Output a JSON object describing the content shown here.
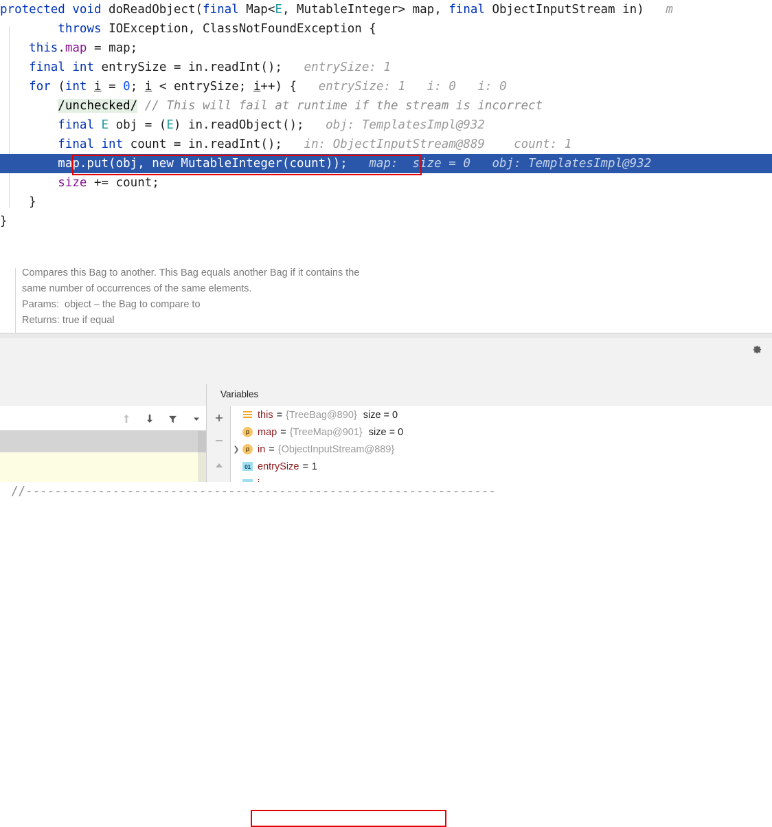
{
  "editor": {
    "lines": [
      {
        "id": "line1",
        "segments": [
          {
            "t": "protected ",
            "c": "kw"
          },
          {
            "t": "void ",
            "c": "kw"
          },
          {
            "t": "doReadObject(",
            "c": "tok"
          },
          {
            "t": "final ",
            "c": "kw"
          },
          {
            "t": "Map<",
            "c": "tok"
          },
          {
            "t": "E",
            "c": "gen"
          },
          {
            "t": ", MutableInteger> map, ",
            "c": "tok"
          },
          {
            "t": "final ",
            "c": "kw"
          },
          {
            "t": "ObjectInputStream in)",
            "c": "tok"
          },
          {
            "t": "   m",
            "c": "hint"
          }
        ]
      },
      {
        "id": "line2",
        "segments": [
          {
            "t": "        ",
            "c": "tok"
          },
          {
            "t": "throws ",
            "c": "kw"
          },
          {
            "t": "IOException, ClassNotFoundException {",
            "c": "tok"
          }
        ]
      },
      {
        "id": "line3",
        "segments": [
          {
            "t": "    ",
            "c": "tok"
          },
          {
            "t": "this",
            "c": "kw"
          },
          {
            "t": ".",
            "c": "tok"
          },
          {
            "t": "map",
            "c": "fld"
          },
          {
            "t": " = map;",
            "c": "tok"
          }
        ]
      },
      {
        "id": "line4",
        "segments": [
          {
            "t": "    ",
            "c": "tok"
          },
          {
            "t": "final ",
            "c": "kw"
          },
          {
            "t": "int ",
            "c": "kw"
          },
          {
            "t": "entrySize = in.readInt();",
            "c": "tok"
          },
          {
            "t": "   entrySize: 1",
            "c": "hint"
          }
        ]
      },
      {
        "id": "line5",
        "segments": [
          {
            "t": "    ",
            "c": "tok"
          },
          {
            "t": "for ",
            "c": "kw"
          },
          {
            "t": "(",
            "c": "tok"
          },
          {
            "t": "int ",
            "c": "kw"
          },
          {
            "t": "i",
            "c": "ul"
          },
          {
            "t": " = ",
            "c": "tok"
          },
          {
            "t": "0",
            "c": "num"
          },
          {
            "t": "; ",
            "c": "tok"
          },
          {
            "t": "i",
            "c": "ul"
          },
          {
            "t": " < entrySize; ",
            "c": "tok"
          },
          {
            "t": "i",
            "c": "ul"
          },
          {
            "t": "++) {",
            "c": "tok"
          },
          {
            "t": "   entrySize: 1   i: 0   i: 0",
            "c": "hint"
          }
        ]
      },
      {
        "id": "line6",
        "segments": [
          {
            "t": "        ",
            "c": "tok"
          },
          {
            "t": "/unchecked/",
            "c": "anno"
          },
          {
            "t": " // This will fail at runtime if the stream is incorrect",
            "c": "cmt"
          }
        ]
      },
      {
        "id": "line7",
        "segments": [
          {
            "t": "        ",
            "c": "tok"
          },
          {
            "t": "final ",
            "c": "kw"
          },
          {
            "t": "E ",
            "c": "gen"
          },
          {
            "t": "obj = (",
            "c": "tok"
          },
          {
            "t": "E",
            "c": "gen"
          },
          {
            "t": ") in.readObject();",
            "c": "tok"
          },
          {
            "t": "   obj: TemplatesImpl@932",
            "c": "hint"
          }
        ]
      },
      {
        "id": "line8",
        "segments": [
          {
            "t": "        ",
            "c": "tok"
          },
          {
            "t": "final ",
            "c": "kw"
          },
          {
            "t": "int ",
            "c": "kw"
          },
          {
            "t": "count = in.readInt();",
            "c": "tok"
          },
          {
            "t": "   in: ObjectInputStream@889    count: 1",
            "c": "hint"
          }
        ]
      },
      {
        "id": "line9",
        "selected": true,
        "segments": [
          {
            "t": "        map.put(obj, ",
            "c": "tok"
          },
          {
            "t": "new ",
            "c": "kw"
          },
          {
            "t": "MutableInteger(count));",
            "c": "tok"
          },
          {
            "t": "   map:  size = 0   obj: TemplatesImpl@932",
            "c": "hint"
          }
        ]
      },
      {
        "id": "line10",
        "segments": [
          {
            "t": "        ",
            "c": "tok"
          },
          {
            "t": "size",
            "c": "fld"
          },
          {
            "t": " += count;",
            "c": "tok"
          }
        ]
      },
      {
        "id": "line11",
        "segments": [
          {
            "t": "    }",
            "c": "tok"
          }
        ]
      },
      {
        "id": "line12",
        "segments": [
          {
            "t": "}",
            "c": "tok"
          }
        ]
      }
    ]
  },
  "doc": {
    "dash_line": "//-----------------------------------------------------------------",
    "paragraph1": "Compares this Bag to another. This Bag equals another Bag if it contains the",
    "paragraph2": "same number of occurrences of the same elements.",
    "params": "Params:  object – the Bag to compare to",
    "returns": "Returns: true if equal"
  },
  "toolstrip": {
    "gear_icon": "gear-icon"
  },
  "debug": {
    "variables_tab_label": "Variables",
    "frames_toolbar": [
      {
        "name": "step-up-icon",
        "glyph": "↑",
        "disabled": true
      },
      {
        "name": "step-down-icon",
        "glyph": "↓",
        "disabled": false
      },
      {
        "name": "filter-icon",
        "glyph": "filter",
        "disabled": false
      },
      {
        "name": "dropdown-chevron-icon",
        "glyph": "▼",
        "disabled": false
      }
    ],
    "vstrip_buttons": [
      {
        "name": "add-watch-button",
        "glyph": "+"
      },
      {
        "name": "remove-watch-button",
        "glyph": "–"
      },
      {
        "name": "collapse-up-button",
        "glyph": "▲"
      }
    ],
    "variables": [
      {
        "icon": "object-icon",
        "icon_label": "",
        "name": "this",
        "value": "{TreeBag@890}",
        "extra": "size = 0",
        "expandable": false,
        "highlighted": false
      },
      {
        "icon": "parameter-icon",
        "icon_label": "p",
        "name": "map",
        "value": "{TreeMap@901}",
        "extra": "size = 0",
        "expandable": false,
        "highlighted": true
      },
      {
        "icon": "parameter-icon",
        "icon_label": "p",
        "name": "in",
        "value": "{ObjectInputStream@889}",
        "extra": "",
        "expandable": true,
        "highlighted": false
      },
      {
        "icon": "primitive-icon",
        "icon_label": "01",
        "name": "entrySize",
        "value": "1",
        "extra": "",
        "expandable": false,
        "highlighted": false,
        "primitive": true
      }
    ]
  },
  "colors": {
    "selection_blue": "#2b57ab",
    "annotation_red": "#e60000",
    "keyword_blue": "#0033b3",
    "field_purple": "#871094",
    "generic_teal": "#20999d",
    "hint_gray": "#9a9a9a",
    "inlay_green": "#e3f0e3"
  }
}
